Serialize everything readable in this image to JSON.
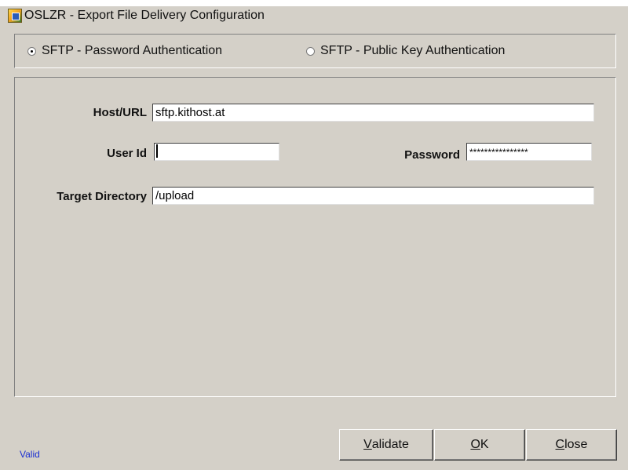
{
  "window": {
    "title": "OSLZR - Export File Delivery Configuration",
    "icon": "application-icon"
  },
  "auth": {
    "options": [
      {
        "label": "SFTP - Password Authentication",
        "selected": true
      },
      {
        "label": "SFTP - Public Key Authentication",
        "selected": false
      }
    ]
  },
  "form": {
    "host_label": "Host/URL",
    "host_value": "sftp.kithost.at",
    "userid_label": "User Id",
    "userid_value": "",
    "password_label": "Password",
    "password_value": "****************",
    "target_label": "Target Directory",
    "target_value": "/upload"
  },
  "status": {
    "text": "Valid",
    "color": "#1a2ed1"
  },
  "buttons": {
    "validate": {
      "mnemonic": "V",
      "rest": "alidate"
    },
    "ok": {
      "mnemonic": "O",
      "rest": "K"
    },
    "close": {
      "mnemonic": "C",
      "rest": "lose"
    }
  },
  "colors": {
    "window_bg": "#d4d0c8"
  }
}
